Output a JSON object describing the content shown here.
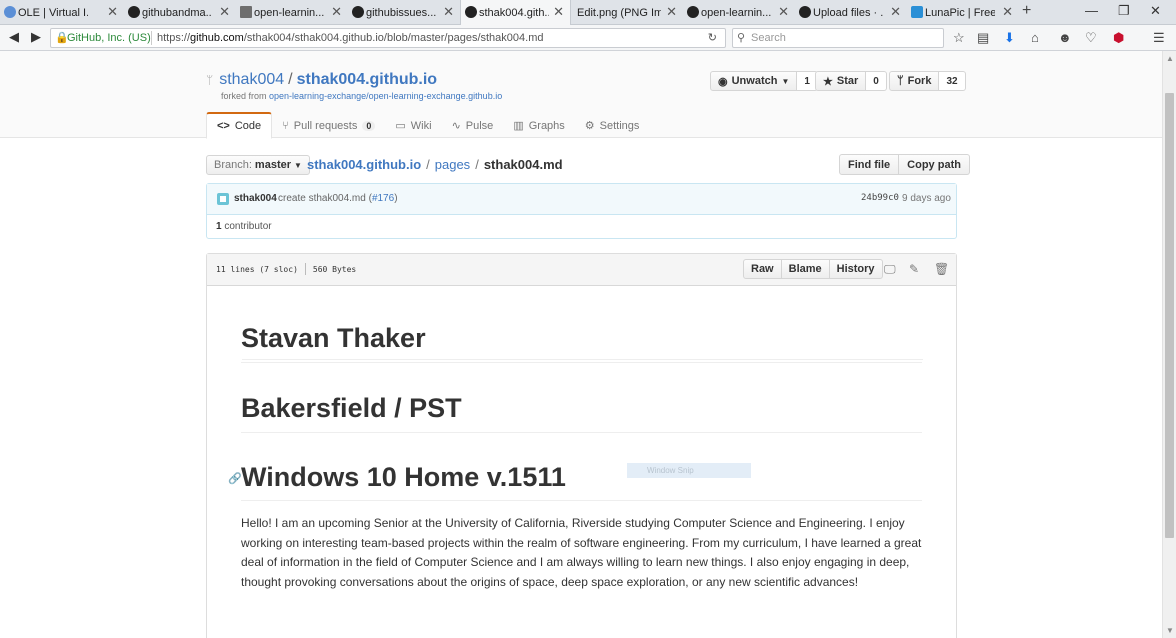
{
  "browser": {
    "tabs": [
      {
        "title": "OLE | Virtual I...",
        "icon": "ole-icon",
        "color": "#5b8fd6",
        "active": false
      },
      {
        "title": "githubandma...",
        "icon": "github-icon",
        "color": "#222222",
        "active": false
      },
      {
        "title": "open-learnin...",
        "icon": "document-icon",
        "color": "#6e6e6e",
        "active": false
      },
      {
        "title": "githubissues...",
        "icon": "github-icon",
        "color": "#222222",
        "active": false
      },
      {
        "title": "sthak004.gith...",
        "icon": "github-icon",
        "color": "#222222",
        "active": true
      },
      {
        "title": "Edit.png (PNG Im...",
        "icon": "",
        "color": "",
        "active": false
      },
      {
        "title": "open-learnin...",
        "icon": "github-icon",
        "color": "#222222",
        "active": false
      },
      {
        "title": "Upload files · ...",
        "icon": "github-icon",
        "color": "#222222",
        "active": false
      },
      {
        "title": "LunaPic | Free...",
        "icon": "lunapic-icon",
        "color": "#2a8fd6",
        "active": false
      }
    ],
    "identity": "GitHub, Inc. (US)",
    "url_prefix": "https://",
    "url_host": "github.com",
    "url_path": "/sthak004/sthak004.github.io/blob/master/pages/sthak004.md",
    "search_placeholder": "Search"
  },
  "repo": {
    "owner": "sthak004",
    "name": "sthak004.github.io",
    "forked_label": "forked from",
    "forked_from": "open-learning-exchange/open-learning-exchange.github.io",
    "watch_label": "Unwatch",
    "watch_count": "1",
    "star_label": "Star",
    "star_count": "0",
    "fork_label": "Fork",
    "fork_count": "32"
  },
  "nav": {
    "code": "Code",
    "pulls": "Pull requests",
    "pulls_count": "0",
    "wiki": "Wiki",
    "pulse": "Pulse",
    "graphs": "Graphs",
    "settings": "Settings"
  },
  "file_nav": {
    "branch_label": "Branch:",
    "branch": "master",
    "crumb_repo": "sthak004.github.io",
    "crumb_dir": "pages",
    "crumb_file": "sthak004.md",
    "find_file": "Find file",
    "copy_path": "Copy path"
  },
  "commit": {
    "author": "sthak004",
    "message": "create sthak004.md (",
    "pr": "#176",
    "message_end": ")",
    "sha": "24b99c0",
    "time": "9 days ago",
    "contributors_count": "1",
    "contributors_label": "contributor"
  },
  "file": {
    "lines": "11 lines (7 sloc)",
    "size": "560 Bytes",
    "raw": "Raw",
    "blame": "Blame",
    "history": "History"
  },
  "content": {
    "h1": "Stavan Thaker",
    "h2": "Bakersfield / PST",
    "h3": "Windows 10 Home v.1511",
    "paragraph": "Hello! I am an upcoming Senior at the University of California, Riverside studying Computer Science and Engineering. I enjoy working on interesting team-based projects within the realm of software engineering. From my curriculum, I have learned a great deal of information in the field of Computer Science and I am always willing to learn new things. I also enjoy engaging in deep, thought provoking conversations about the origins of space, deep space exploration, or any new scientific advances!"
  },
  "overlay": {
    "snip_label": "Window Snip"
  }
}
